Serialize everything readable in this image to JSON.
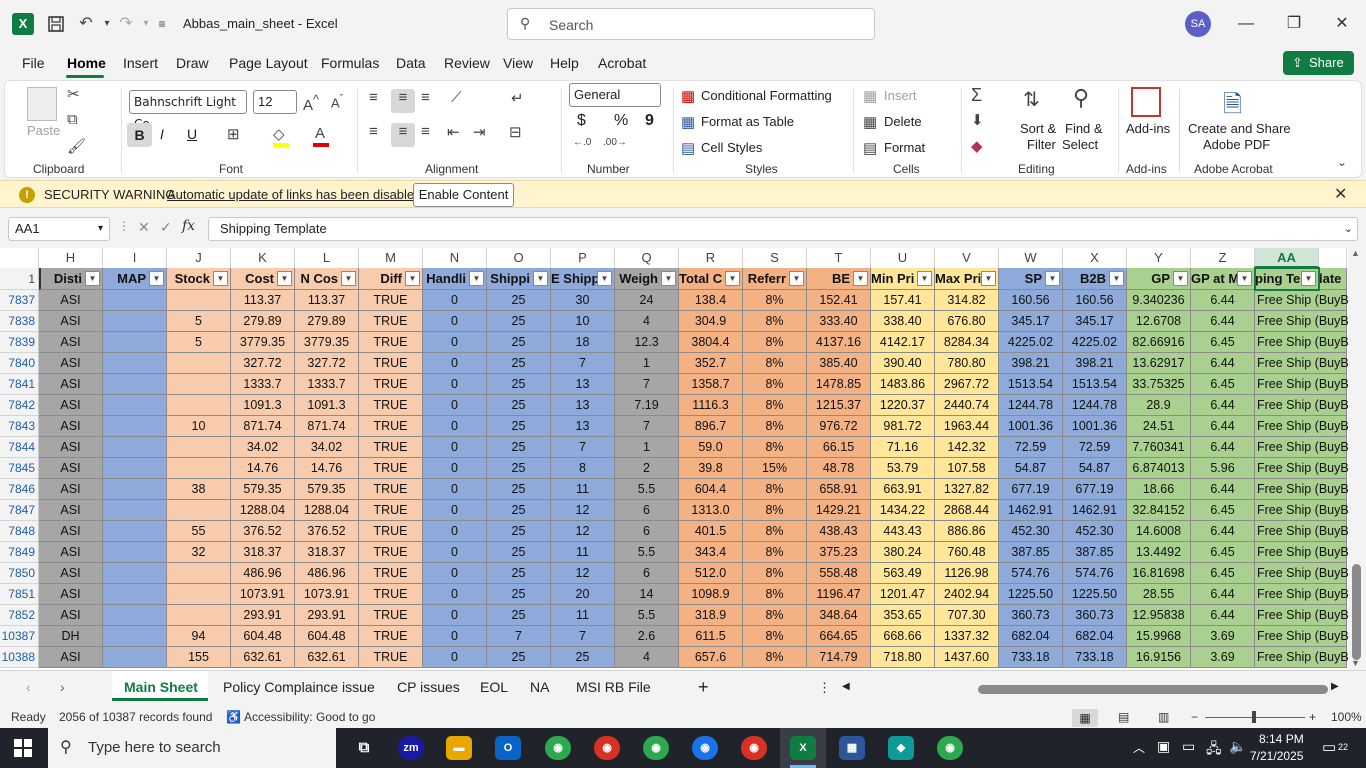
{
  "app": {
    "title": "Abbas_main_sheet  -  Excel",
    "search_placeholder": "Search",
    "avatar_initials": "SA",
    "share_label": "Share"
  },
  "menu": [
    "File",
    "Home",
    "Insert",
    "Draw",
    "Page Layout",
    "Formulas",
    "Data",
    "Review",
    "View",
    "Help",
    "Acrobat"
  ],
  "ribbon": {
    "clipboard": {
      "paste": "Paste",
      "label": "Clipboard"
    },
    "font": {
      "name": "Bahnschrift Light Co",
      "size": "12",
      "bold": "B",
      "italic": "I",
      "underline": "U",
      "label": "Font"
    },
    "alignment": {
      "label": "Alignment"
    },
    "number": {
      "format": "General",
      "currency": "$",
      "percent": "%",
      "comma": "9",
      "label": "Number"
    },
    "styles": {
      "conditional": "Conditional Formatting",
      "format_table": "Format as Table",
      "cell_styles": "Cell Styles",
      "label": "Styles"
    },
    "cells": {
      "insert": "Insert",
      "delete": "Delete",
      "format": "Format",
      "label": "Cells"
    },
    "editing": {
      "sort1": "Sort &",
      "sort2": "Filter",
      "find1": "Find &",
      "find2": "Select",
      "label": "Editing"
    },
    "addins": {
      "btn": "Add-ins",
      "label": "Add-ins"
    },
    "acrobat": {
      "btn1": "Create and Share",
      "btn2": "Adobe PDF",
      "label": "Adobe Acrobat"
    }
  },
  "security": {
    "title": "SECURITY WARNING",
    "message": "Automatic update of links has been disabled",
    "button": "Enable Content"
  },
  "formula_bar": {
    "name_box": "AA1",
    "fx": "fx",
    "value": "Shipping Template"
  },
  "colors": {
    "accent": "#107c41",
    "grey": "#a6a6a6",
    "blue": "#8eaadb",
    "peach": "#f8cbad",
    "salmon": "#f4b183",
    "yellow": "#ffe699",
    "green": "#a9d08e"
  },
  "columns": [
    {
      "letter": "H",
      "header": "Disti",
      "w": 64,
      "color": "grey"
    },
    {
      "letter": "I",
      "header": "MAP",
      "w": 64,
      "color": "blue"
    },
    {
      "letter": "J",
      "header": "Stock",
      "w": 64,
      "color": "peach"
    },
    {
      "letter": "K",
      "header": "Cost",
      "w": 64,
      "color": "peach"
    },
    {
      "letter": "L",
      "header": "N Cos",
      "w": 64,
      "color": "peach"
    },
    {
      "letter": "M",
      "header": "Diff",
      "w": 64,
      "color": "peach"
    },
    {
      "letter": "N",
      "header": "Handli",
      "w": 64,
      "color": "blue"
    },
    {
      "letter": "O",
      "header": "Shippi",
      "w": 64,
      "color": "blue"
    },
    {
      "letter": "P",
      "header": "E Shipp",
      "w": 64,
      "color": "blue"
    },
    {
      "letter": "Q",
      "header": "Weigh",
      "w": 64,
      "color": "grey"
    },
    {
      "letter": "R",
      "header": "Total C",
      "w": 64,
      "color": "salmon"
    },
    {
      "letter": "S",
      "header": "Referr",
      "w": 64,
      "color": "salmon"
    },
    {
      "letter": "T",
      "header": "BE",
      "w": 64,
      "color": "salmon"
    },
    {
      "letter": "U",
      "header": "Min Pri",
      "w": 64,
      "color": "yellow"
    },
    {
      "letter": "V",
      "header": "Max Pri",
      "w": 64,
      "color": "yellow"
    },
    {
      "letter": "W",
      "header": "SP",
      "w": 64,
      "color": "blue"
    },
    {
      "letter": "X",
      "header": "B2B",
      "w": 64,
      "color": "blue"
    },
    {
      "letter": "Y",
      "header": "GP",
      "w": 64,
      "color": "green"
    },
    {
      "letter": "Z",
      "header": "GP at M",
      "w": 64,
      "color": "green"
    },
    {
      "letter": "AA",
      "header": "ping Te",
      "w": 64,
      "color": "green"
    },
    {
      "letter": "",
      "header": "late",
      "w": 28,
      "color": "green"
    }
  ],
  "rows": [
    {
      "n": "7837",
      "c": [
        "ASI",
        "",
        "",
        "113.37",
        "113.37",
        "TRUE",
        "0",
        "25",
        "30",
        "24",
        "138.4",
        "8%",
        "152.41",
        "157.41",
        "314.82",
        "160.56",
        "160.56",
        "9.340236",
        "6.44",
        "Free Ship (BuyBox)",
        ""
      ]
    },
    {
      "n": "7838",
      "c": [
        "ASI",
        "",
        "5",
        "279.89",
        "279.89",
        "TRUE",
        "0",
        "25",
        "10",
        "4",
        "304.9",
        "8%",
        "333.40",
        "338.40",
        "676.80",
        "345.17",
        "345.17",
        "12.6708",
        "6.44",
        "Free Ship (BuyBox)",
        ""
      ]
    },
    {
      "n": "7839",
      "c": [
        "ASI",
        "",
        "5",
        "3779.35",
        "3779.35",
        "TRUE",
        "0",
        "25",
        "18",
        "12.3",
        "3804.4",
        "8%",
        "4137.16",
        "4142.17",
        "8284.34",
        "4225.02",
        "4225.02",
        "82.66916",
        "6.45",
        "Free Ship (BuyBox)",
        ""
      ]
    },
    {
      "n": "7840",
      "c": [
        "ASI",
        "",
        "",
        "327.72",
        "327.72",
        "TRUE",
        "0",
        "25",
        "7",
        "1",
        "352.7",
        "8%",
        "385.40",
        "390.40",
        "780.80",
        "398.21",
        "398.21",
        "13.62917",
        "6.44",
        "Free Ship (BuyBox)",
        ""
      ]
    },
    {
      "n": "7841",
      "c": [
        "ASI",
        "",
        "",
        "1333.7",
        "1333.7",
        "TRUE",
        "0",
        "25",
        "13",
        "7",
        "1358.7",
        "8%",
        "1478.85",
        "1483.86",
        "2967.72",
        "1513.54",
        "1513.54",
        "33.75325",
        "6.45",
        "Free Ship (BuyBox)",
        ""
      ]
    },
    {
      "n": "7842",
      "c": [
        "ASI",
        "",
        "",
        "1091.3",
        "1091.3",
        "TRUE",
        "0",
        "25",
        "13",
        "7.19",
        "1116.3",
        "8%",
        "1215.37",
        "1220.37",
        "2440.74",
        "1244.78",
        "1244.78",
        "28.9",
        "6.44",
        "Free Ship (BuyBox)",
        ""
      ]
    },
    {
      "n": "7843",
      "c": [
        "ASI",
        "",
        "10",
        "871.74",
        "871.74",
        "TRUE",
        "0",
        "25",
        "13",
        "7",
        "896.7",
        "8%",
        "976.72",
        "981.72",
        "1963.44",
        "1001.36",
        "1001.36",
        "24.51",
        "6.44",
        "Free Ship (BuyBox)",
        ""
      ]
    },
    {
      "n": "7844",
      "c": [
        "ASI",
        "",
        "",
        "34.02",
        "34.02",
        "TRUE",
        "0",
        "25",
        "7",
        "1",
        "59.0",
        "8%",
        "66.15",
        "71.16",
        "142.32",
        "72.59",
        "72.59",
        "7.760341",
        "6.44",
        "Free Ship (BuyBox)",
        ""
      ]
    },
    {
      "n": "7845",
      "c": [
        "ASI",
        "",
        "",
        "14.76",
        "14.76",
        "TRUE",
        "0",
        "25",
        "8",
        "2",
        "39.8",
        "15%",
        "48.78",
        "53.79",
        "107.58",
        "54.87",
        "54.87",
        "6.874013",
        "5.96",
        "Free Ship (BuyBox)",
        ""
      ]
    },
    {
      "n": "7846",
      "c": [
        "ASI",
        "",
        "38",
        "579.35",
        "579.35",
        "TRUE",
        "0",
        "25",
        "11",
        "5.5",
        "604.4",
        "8%",
        "658.91",
        "663.91",
        "1327.82",
        "677.19",
        "677.19",
        "18.66",
        "6.44",
        "Free Ship (BuyBox)",
        ""
      ]
    },
    {
      "n": "7847",
      "c": [
        "ASI",
        "",
        "",
        "1288.04",
        "1288.04",
        "TRUE",
        "0",
        "25",
        "12",
        "6",
        "1313.0",
        "8%",
        "1429.21",
        "1434.22",
        "2868.44",
        "1462.91",
        "1462.91",
        "32.84152",
        "6.45",
        "Free Ship (BuyBox)",
        ""
      ]
    },
    {
      "n": "7848",
      "c": [
        "ASI",
        "",
        "55",
        "376.52",
        "376.52",
        "TRUE",
        "0",
        "25",
        "12",
        "6",
        "401.5",
        "8%",
        "438.43",
        "443.43",
        "886.86",
        "452.30",
        "452.30",
        "14.6008",
        "6.44",
        "Free Ship (BuyBox)",
        ""
      ]
    },
    {
      "n": "7849",
      "c": [
        "ASI",
        "",
        "32",
        "318.37",
        "318.37",
        "TRUE",
        "0",
        "25",
        "11",
        "5.5",
        "343.4",
        "8%",
        "375.23",
        "380.24",
        "760.48",
        "387.85",
        "387.85",
        "13.4492",
        "6.45",
        "Free Ship (BuyBox)",
        ""
      ]
    },
    {
      "n": "7850",
      "c": [
        "ASI",
        "",
        "",
        "486.96",
        "486.96",
        "TRUE",
        "0",
        "25",
        "12",
        "6",
        "512.0",
        "8%",
        "558.48",
        "563.49",
        "1126.98",
        "574.76",
        "574.76",
        "16.81698",
        "6.45",
        "Free Ship (BuyBox)",
        ""
      ]
    },
    {
      "n": "7851",
      "c": [
        "ASI",
        "",
        "",
        "1073.91",
        "1073.91",
        "TRUE",
        "0",
        "25",
        "20",
        "14",
        "1098.9",
        "8%",
        "1196.47",
        "1201.47",
        "2402.94",
        "1225.50",
        "1225.50",
        "28.55",
        "6.44",
        "Free Ship (BuyBox)",
        ""
      ]
    },
    {
      "n": "7852",
      "c": [
        "ASI",
        "",
        "",
        "293.91",
        "293.91",
        "TRUE",
        "0",
        "25",
        "11",
        "5.5",
        "318.9",
        "8%",
        "348.64",
        "353.65",
        "707.30",
        "360.73",
        "360.73",
        "12.95838",
        "6.44",
        "Free Ship (BuyBox)",
        ""
      ]
    },
    {
      "n": "10387",
      "c": [
        "DH",
        "",
        "94",
        "604.48",
        "604.48",
        "TRUE",
        "0",
        "7",
        "7",
        "2.6",
        "611.5",
        "8%",
        "664.65",
        "668.66",
        "1337.32",
        "682.04",
        "682.04",
        "15.9968",
        "3.69",
        "Free Ship (BuyBox)",
        ""
      ]
    },
    {
      "n": "10388",
      "c": [
        "ASI",
        "",
        "155",
        "632.61",
        "632.61",
        "TRUE",
        "0",
        "25",
        "25",
        "4",
        "657.6",
        "8%",
        "714.79",
        "718.80",
        "1437.60",
        "733.18",
        "733.18",
        "16.9156",
        "3.69",
        "Free Ship (BuyBox)",
        ""
      ]
    }
  ],
  "sheets": [
    "Main Sheet",
    "Policy Complaince issue",
    "CP issues",
    "EOL",
    "NA",
    "MSI RB File"
  ],
  "status": {
    "ready": "Ready",
    "records": "2056 of 10387 records found",
    "accessibility": "Accessibility: Good to go",
    "zoom": "100%"
  },
  "taskbar": {
    "search_placeholder": "Type here to search",
    "time": "8:14 PM",
    "date": "7/21/2025",
    "notif": "22"
  }
}
